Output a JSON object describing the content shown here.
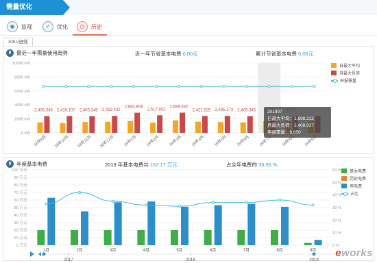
{
  "title": "需量优化",
  "nav": [
    {
      "label": "监视",
      "icon": "monitor-icon"
    },
    {
      "label": "优化",
      "icon": "optimize-icon"
    },
    {
      "label": "历史",
      "icon": "history-clock-icon"
    }
  ],
  "subtab": "10KV进线",
  "panel1": {
    "title": "最近一年需量使用趋势",
    "stat1_label": "近一年节省基本电费",
    "stat1_value": "0.00元",
    "stat2_label": "累计节省基本电费",
    "stat2_value": "0.00元",
    "legend": [
      "日最大平均",
      "月最大负荷",
      "申报需量"
    ]
  },
  "tooltip": {
    "period": "201907",
    "line1": "日最大平均：1,698.212",
    "line2": "月最大负荷：2,408.027",
    "line3": "申报需量：6,650"
  },
  "panel2": {
    "title": "年度基本电费",
    "stat1_label": "2019 年基本电费共",
    "stat1_value": "162.17 万元",
    "stat2_label": "占全年电费的",
    "stat2_value": "36.56 %",
    "legend": [
      "基本电费",
      "罚款电费",
      "用电费",
      "占比"
    ]
  },
  "timeline": {
    "years": [
      "2017",
      "2018",
      "2019"
    ]
  },
  "watermark": {
    "e": "e",
    "rest": "works"
  },
  "chart_data": [
    {
      "type": "bar",
      "title": "最近一年需量使用趋势",
      "categories": [
        "18年8月",
        "18年10月",
        "18年11月",
        "18年12月",
        "19年1月",
        "19年2月",
        "19年3月",
        "19年4月",
        "19年5月",
        "19年6月",
        "19年7月",
        "19年8月",
        "19年9月"
      ],
      "series": [
        {
          "name": "日最大平均",
          "type": "bar",
          "color": "#f5a623",
          "values": [
            1500,
            1400,
            1550,
            1600,
            1700,
            1450,
            1800,
            1600,
            1550,
            1500,
            1698.212,
            1650,
            1600
          ]
        },
        {
          "name": "月最大负荷",
          "type": "bar",
          "color": "#c94a4a",
          "values": [
            2405.345,
            2416.107,
            2405.345,
            2432.432,
            2884.808,
            2517.902,
            2889.632,
            2421.525,
            2435.173,
            2405.345,
            2408.027,
            2416.027,
            2400
          ]
        },
        {
          "name": "申报需量",
          "type": "line",
          "color": "#3bbbd0",
          "values": [
            6650,
            6650,
            6650,
            6650,
            6650,
            6650,
            6650,
            6650,
            6650,
            6650,
            6650,
            6650,
            6650
          ]
        }
      ],
      "data_labels": [
        "2,405.345",
        "2,416.107",
        "2,405.345",
        "2,432.432",
        "2,884.808",
        "2,517.902",
        "2,889.632",
        "2,421.525",
        "2,435.173",
        "2,405.345",
        "2,40",
        "6.027",
        ""
      ],
      "yticks": [
        "10000 kW",
        "8000 kW",
        "6000 kW",
        "4000 kW",
        "2000 kW",
        "0 kW"
      ],
      "ylim": [
        0,
        10000
      ],
      "highlight_category": "19年7月",
      "legend_position": "right"
    },
    {
      "type": "bar",
      "title": "年度基本电费",
      "categories": [
        "1月",
        "2月",
        "3月",
        "4月",
        "5月",
        "6月",
        "7月",
        "8月",
        "9月"
      ],
      "series": [
        {
          "name": "基本电费",
          "type": "bar",
          "color": "#3fae49",
          "values": [
            20,
            20,
            20,
            20,
            20,
            20,
            20,
            20,
            3
          ]
        },
        {
          "name": "罚款电费",
          "type": "bar",
          "color": "#e8833a",
          "values": [
            0,
            0,
            0,
            0,
            0,
            0,
            0,
            0,
            0
          ]
        },
        {
          "name": "用电费",
          "type": "bar",
          "color": "#2c8fc9",
          "values": [
            63,
            45,
            57,
            58,
            51,
            53,
            55,
            51,
            7
          ]
        },
        {
          "name": "占比",
          "type": "line",
          "color": "#3bbbd0",
          "axis": "right",
          "values": [
            33,
            42,
            35,
            32,
            31,
            34,
            34,
            36,
            32
          ]
        }
      ],
      "yticks_left": [
        "100 万元",
        "90 万元",
        "80 万元",
        "70 万元",
        "60 万元",
        "50 万元",
        "40 万元",
        "30 万元",
        "20 万元",
        "10 万元",
        "0 万元"
      ],
      "yticks_right": [
        "60 %",
        "50 %",
        "40 %",
        "30 %",
        "20 %",
        "10 %",
        "0 %"
      ],
      "ylim": [
        0,
        100
      ],
      "ylim_right": [
        0,
        60
      ],
      "legend_position": "right"
    }
  ]
}
